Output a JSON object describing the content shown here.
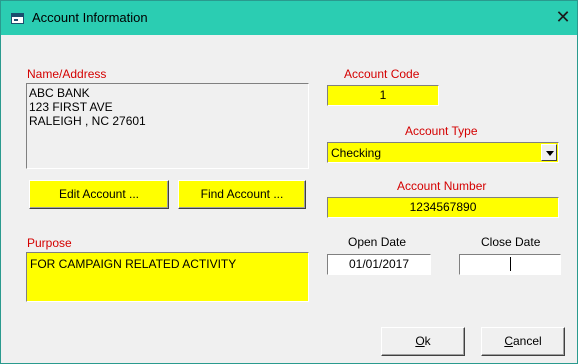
{
  "window": {
    "title": "Account Information",
    "close_symbol": "✕",
    "accent_color": "#2bcdb2"
  },
  "name_address": {
    "label": "Name/Address",
    "lines": [
      "ABC BANK",
      "123 FIRST AVE",
      "RALEIGH , NC 27601"
    ]
  },
  "account_code": {
    "label": "Account Code",
    "value": "1"
  },
  "account_type": {
    "label": "Account Type",
    "selected": "Checking"
  },
  "account_number": {
    "label": "Account Number",
    "value": "1234567890"
  },
  "buttons": {
    "edit_account": "Edit Account ...",
    "find_account": "Find Account ...",
    "ok_prefix": "O",
    "ok_rest": "k",
    "cancel_prefix": "C",
    "cancel_rest": "ancel"
  },
  "purpose": {
    "label": "Purpose",
    "value": "FOR CAMPAIGN RELATED ACTIVITY"
  },
  "open_date": {
    "label": "Open Date",
    "value": "01/01/2017"
  },
  "close_date": {
    "label": "Close Date",
    "value": ""
  },
  "colors": {
    "field_bg": "#ffff00",
    "label_red": "#d40000"
  }
}
